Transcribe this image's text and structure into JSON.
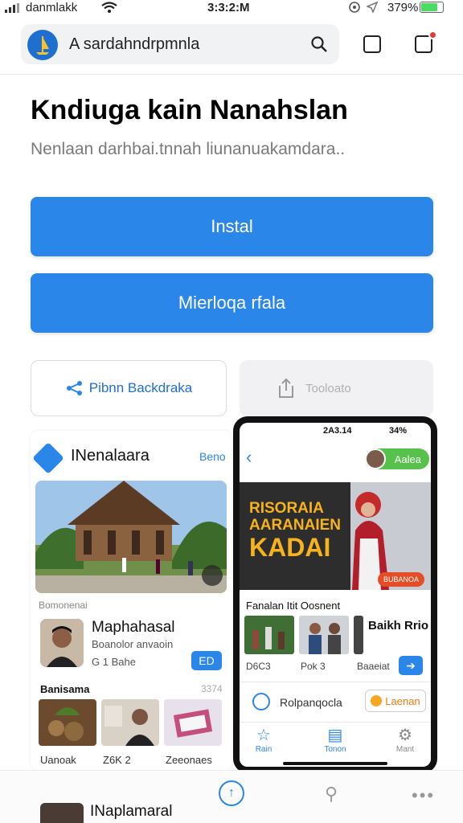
{
  "status_bar": {
    "carrier": "danmlakk",
    "time": "3:3:2:M",
    "battery_percent": "379%"
  },
  "address_bar": {
    "url": "A sardahndrpmnla"
  },
  "header": {
    "title": "Kndiuga kain Nanahslan",
    "subtitle": "Nenlaan darhbai.tnnah liunanuakamdara.."
  },
  "actions": {
    "install_label": "Instal",
    "secondary_label": "Mierloqa rfala",
    "outline_label": "Pibnn Backdraka",
    "grey_label": "Tooloato"
  },
  "left_card": {
    "title": "INenalaara",
    "link": "Beno",
    "caption": "Bomonenai",
    "profile_name": "Maphahasal",
    "profile_sub": "Boanolor anvaoin",
    "profile_meta": "G 1 Bahe",
    "profile_button": "ED",
    "section_title": "Banisama",
    "section_count": "3374",
    "thumbs": [
      {
        "label": "Uanoak"
      },
      {
        "label": "Z6K 2"
      },
      {
        "label": "Zeeonaes"
      }
    ]
  },
  "phone": {
    "status_time": "2A3.14",
    "status_batt": "34%",
    "user_label": "Aalea",
    "hero_line1": "RISORAIA",
    "hero_line2": "AARANAIEN",
    "hero_big": "KADAI",
    "hero_pill": "BUBANOA",
    "section_title": "Fanalan Itit Oosnent",
    "thumbs": [
      {
        "label": "D6C3"
      },
      {
        "label": "Pok 3"
      },
      {
        "label": "Baaeiat"
      }
    ],
    "side_title": "Baikh Rrio",
    "row_label": "Rolpanqocla",
    "row_button": "Laenan",
    "tabs": [
      {
        "label": "Rain",
        "icon": "star-icon"
      },
      {
        "label": "Tonon",
        "icon": "document-icon"
      },
      {
        "label": "Mant",
        "icon": "settings-icon"
      }
    ]
  },
  "bottom_bar": {
    "tab_title": "INaplamaral"
  },
  "colors": {
    "accent": "#2b86ea",
    "green": "#56c14b",
    "orange": "#e44d26"
  }
}
